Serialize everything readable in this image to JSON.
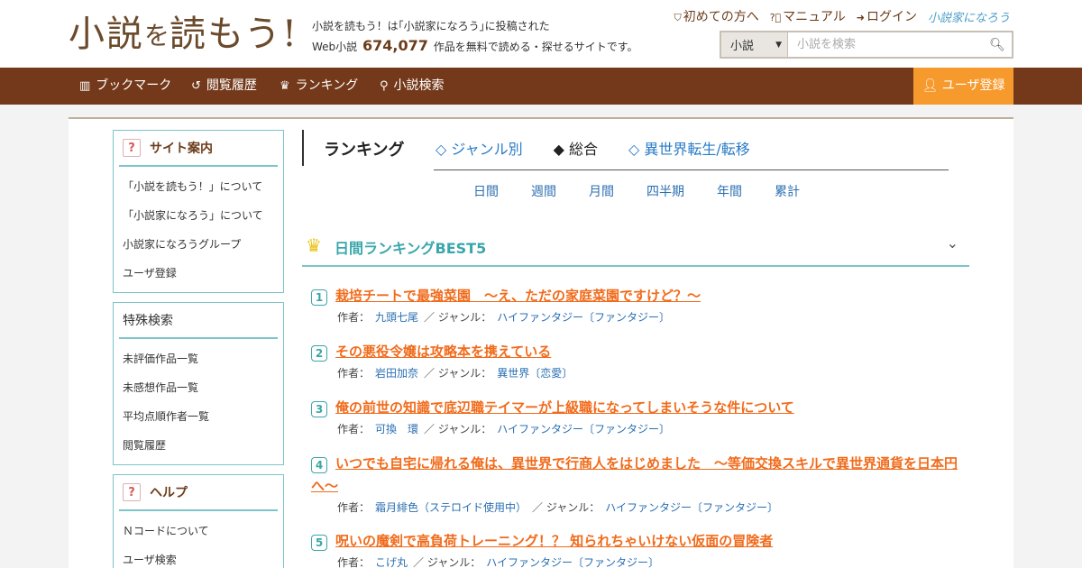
{
  "header": {
    "logo_main": "小説",
    "logo_small": "を",
    "logo_tail": "読もう!",
    "tagline_line1": "小説を読もう！は｢小説家になろう｣に投稿された",
    "tagline_prefix": "Web小説",
    "work_count": "674,077",
    "tagline_suffix": "作品を無料で読める・探せるサイトです。",
    "links": {
      "beginner": "初めての方へ",
      "manual": "マニュアル",
      "login": "ログイン",
      "narou": "小説家になろう"
    },
    "search": {
      "category": "小説",
      "placeholder": "小説を検索"
    }
  },
  "nav": {
    "bookmark": "ブックマーク",
    "history": "閲覧履歴",
    "ranking": "ランキング",
    "search": "小説検索",
    "register": "ユーザ登録"
  },
  "sidebar": {
    "site_guide": {
      "title": "サイト案内",
      "items": [
        "「小説を読もう！」について",
        "「小説家になろう」について",
        "小説家になろうグループ",
        "ユーザ登録"
      ]
    },
    "special_search": {
      "title": "特殊検索",
      "items": [
        "未評価作品一覧",
        "未感想作品一覧",
        "平均点順作者一覧",
        "閲覧履歴"
      ]
    },
    "help": {
      "title": "ヘルプ",
      "items": [
        "Ｎコードについて",
        "ユーザ検索"
      ]
    }
  },
  "ranking": {
    "label": "ランキング",
    "tabs": [
      "◇ ジャンル別",
      "◆ 総合",
      "◇ 異世界転生/転移"
    ],
    "active_tab": 1,
    "periods": [
      "日間",
      "週間",
      "月間",
      "四半期",
      "年間",
      "累計"
    ],
    "best_title": "日間ランキングBEST5",
    "author_label": "作者：",
    "genre_sep": "／ ジャンル：",
    "entries": [
      {
        "rank": "1",
        "title": "栽培チートで最強菜園　～え、ただの家庭菜園ですけど？～",
        "author": "九頭七尾",
        "genre": "ハイファンタジー〔ファンタジー〕"
      },
      {
        "rank": "2",
        "title": "その悪役令嬢は攻略本を携えている",
        "author": "岩田加奈",
        "genre": "異世界〔恋愛〕"
      },
      {
        "rank": "3",
        "title": "俺の前世の知識で底辺職テイマーが上級職になってしまいそうな件について",
        "author": "可換　環",
        "genre": "ハイファンタジー〔ファンタジー〕"
      },
      {
        "rank": "4",
        "title": "いつでも自宅に帰れる俺は、異世界で行商人をはじめました　～等価交換スキルで異世界通貨を日本円へ～",
        "author": "霜月緋色（ステロイド使用中）",
        "genre": "ハイファンタジー〔ファンタジー〕"
      },
      {
        "rank": "5",
        "title": "呪いの魔剣で高負荷トレーニング！？ 知られちゃいけない仮面の冒険者",
        "author": "こげ丸",
        "genre": "ハイファンタジー〔ファンタジー〕"
      }
    ]
  }
}
